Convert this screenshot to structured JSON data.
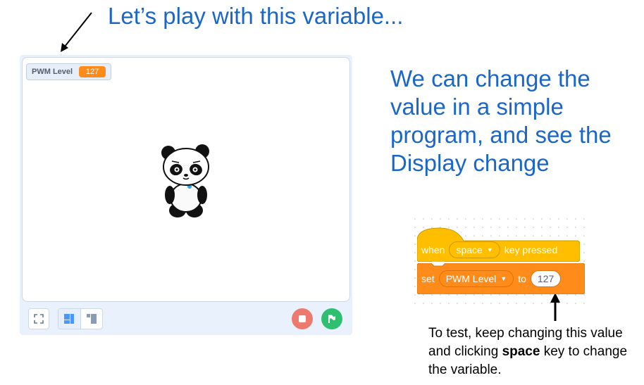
{
  "annotation": {
    "title": "Let’s play with this variable...",
    "description": "We can change the value in a simple program, and see the Display change",
    "note_part1": "To test, keep changing this value and clicking ",
    "note_bold": "space",
    "note_part2": " key to change the variable."
  },
  "stage": {
    "monitor_label": "PWM Level",
    "monitor_value": "127",
    "sprite_icon": "panda-sprite",
    "fullscreen_icon": "fullscreen-icon",
    "stop_icon": "stop-icon",
    "green_flag_icon": "green-flag-icon"
  },
  "blocks": {
    "hat_when": "when",
    "hat_key": "space",
    "hat_pressed": "key pressed",
    "set_label": "set",
    "set_variable": "PWM Level",
    "set_to": "to",
    "set_value": "127"
  },
  "colors": {
    "accent_text": "#1a66c9",
    "events_block": "#ffbf00",
    "variables_block": "#ff8c1a",
    "stop_button": "#ec7a6f",
    "green_flag": "#2fbf71"
  }
}
